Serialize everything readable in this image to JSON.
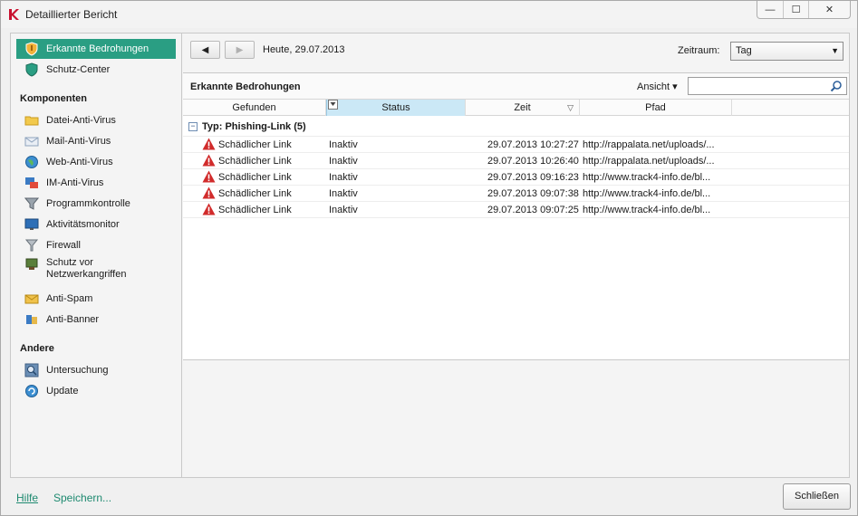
{
  "window": {
    "title": "Detaillierter Bericht",
    "controls": {
      "minimize": "—",
      "maximize": "☐",
      "close": "✕"
    }
  },
  "sidebar": {
    "top_items": [
      {
        "label": "Erkannte Bedrohungen",
        "icon": "shield-icon",
        "active": true
      },
      {
        "label": "Schutz-Center",
        "icon": "shield-icon",
        "active": false
      }
    ],
    "components_heading": "Komponenten",
    "components": [
      {
        "label": "Datei-Anti-Virus",
        "icon": "folder-icon"
      },
      {
        "label": "Mail-Anti-Virus",
        "icon": "mail-icon"
      },
      {
        "label": "Web-Anti-Virus",
        "icon": "globe-icon"
      },
      {
        "label": "IM-Anti-Virus",
        "icon": "chat-icon"
      },
      {
        "label": "Programmkontrolle",
        "icon": "funnel-icon"
      },
      {
        "label": "Aktivitätsmonitor",
        "icon": "monitor-icon"
      },
      {
        "label": "Firewall",
        "icon": "firewall-icon"
      },
      {
        "label_line1": "Schutz vor",
        "label_line2": "Netzwerkangriffen",
        "icon": "network-icon"
      },
      {
        "label": "Anti-Spam",
        "icon": "envelope-icon"
      },
      {
        "label": "Anti-Banner",
        "icon": "banner-icon"
      }
    ],
    "other_heading": "Andere",
    "other": [
      {
        "label": "Untersuchung",
        "icon": "scan-icon"
      },
      {
        "label": "Update",
        "icon": "update-icon"
      }
    ]
  },
  "toolbar": {
    "back_glyph": "◀",
    "forward_glyph": "▶",
    "date": "Heute, 29.07.2013",
    "range_label": "Zeitraum:",
    "range_value": "Tag",
    "dropdown_glyph": "▼"
  },
  "panel": {
    "title": "Erkannte Bedrohungen",
    "view_label": "Ansicht ▾",
    "search_placeholder": ""
  },
  "columns": [
    "Gefunden",
    "Status",
    "Zeit",
    "Pfad"
  ],
  "group": {
    "toggle": "−",
    "label": "Typ: Phishing-Link (5)"
  },
  "rows": [
    {
      "found": "Schädlicher Link",
      "status": "Inaktiv",
      "time": "29.07.2013 10:27:27",
      "path": "http://rappalata.net/uploads/..."
    },
    {
      "found": "Schädlicher Link",
      "status": "Inaktiv",
      "time": "29.07.2013 10:26:40",
      "path": "http://rappalata.net/uploads/..."
    },
    {
      "found": "Schädlicher Link",
      "status": "Inaktiv",
      "time": "29.07.2013 09:16:23",
      "path": "http://www.track4-info.de/bl..."
    },
    {
      "found": "Schädlicher Link",
      "status": "Inaktiv",
      "time": "29.07.2013 09:07:38",
      "path": "http://www.track4-info.de/bl..."
    },
    {
      "found": "Schädlicher Link",
      "status": "Inaktiv",
      "time": "29.07.2013 09:07:25",
      "path": "http://www.track4-info.de/bl..."
    }
  ],
  "footer": {
    "help": "Hilfe",
    "save": "Speichern...",
    "close": "Schließen"
  },
  "colors": {
    "accent": "#2a9e83",
    "link": "#1e8a70",
    "status_header": "#cbe8f6",
    "warning": "#d12b2b"
  }
}
